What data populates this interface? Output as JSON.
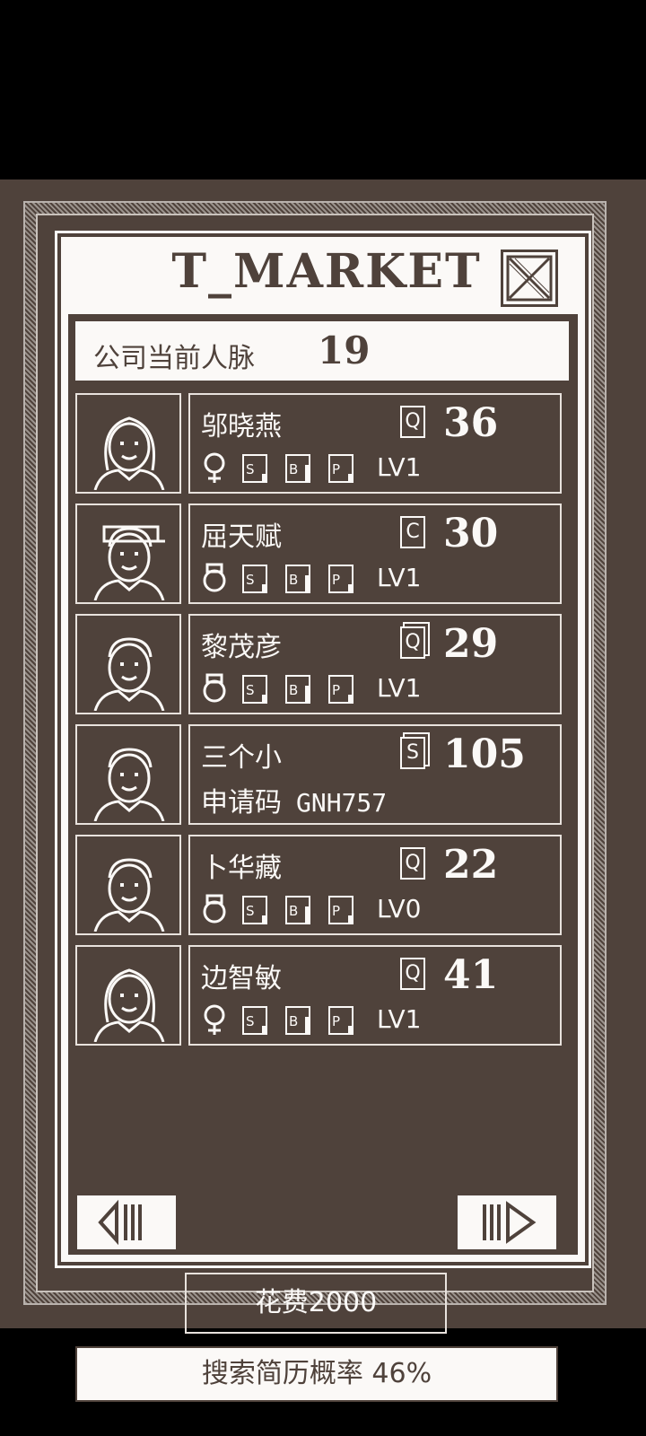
{
  "title": "T_MARKET",
  "info": {
    "label": "公司当前人脉",
    "value": "19"
  },
  "candidates": [
    {
      "name": "邬晓燕",
      "grade": "Q",
      "grade_double": false,
      "score": "36",
      "gender": "female",
      "skills": [
        "S",
        "B",
        "P"
      ],
      "level": "LV1"
    },
    {
      "name": "屈天赋",
      "grade": "C",
      "grade_double": false,
      "score": "30",
      "gender": "male",
      "skills": [
        "S",
        "B",
        "P"
      ],
      "level": "LV1"
    },
    {
      "name": "黎茂彦",
      "grade": "Q",
      "grade_double": true,
      "score": "29",
      "gender": "male",
      "skills": [
        "S",
        "B",
        "P"
      ],
      "level": "LV1"
    },
    {
      "name": "三个小",
      "grade": "S",
      "grade_double": true,
      "score": "105",
      "code_label": "申请码",
      "code": "GNH757"
    },
    {
      "name": "卜华藏",
      "grade": "Q",
      "grade_double": false,
      "score": "22",
      "gender": "male",
      "skills": [
        "S",
        "B",
        "P"
      ],
      "level": "LV0"
    },
    {
      "name": "边智敏",
      "grade": "Q",
      "grade_double": false,
      "score": "41",
      "gender": "female",
      "skills": [
        "S",
        "B",
        "P"
      ],
      "level": "LV1"
    }
  ],
  "footer": {
    "cost": "花费2000",
    "search": "搜索简历概率 46%"
  },
  "colors": {
    "dark": "#4f423b",
    "light": "#fbf9f7"
  }
}
